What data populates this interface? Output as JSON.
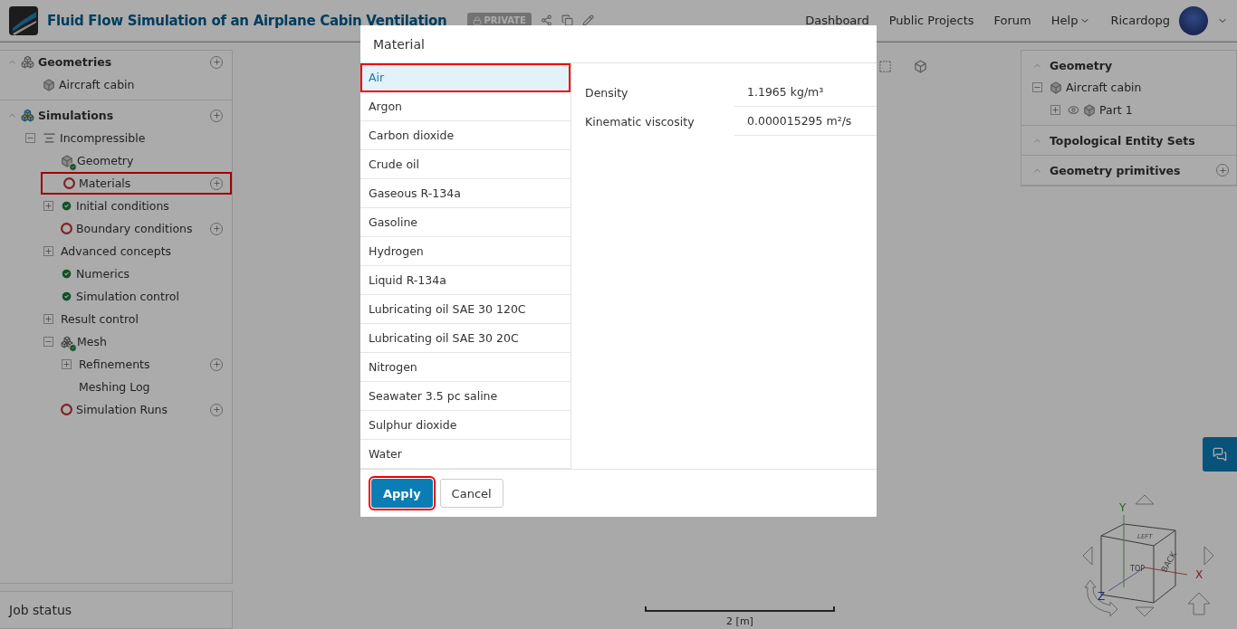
{
  "header": {
    "title": "Fluid Flow Simulation of an Airplane Cabin Ventilation",
    "badge": "PRIVATE",
    "nav": [
      {
        "label": "Dashboard",
        "menu": false
      },
      {
        "label": "Public Projects",
        "menu": false
      },
      {
        "label": "Forum",
        "menu": false
      },
      {
        "label": "Help",
        "menu": true
      }
    ],
    "user": "Ricardopg"
  },
  "left_tree": [
    {
      "label": "Geometries",
      "kind": "cubes",
      "addable": true,
      "children": [
        {
          "label": "Aircraft cabin",
          "kind": "part"
        }
      ]
    },
    {
      "label": "Simulations",
      "kind": "cubes-color",
      "addable": true,
      "children": [
        {
          "label": "Incompressible",
          "kind": "lines",
          "expanded": true,
          "children": [
            {
              "label": "Geometry",
              "kind": "part",
              "complete": true
            },
            {
              "label": "Materials",
              "kind": "plain",
              "complete": false,
              "addable": true,
              "highlighted": true
            },
            {
              "label": "Initial conditions",
              "kind": "plain",
              "complete": true,
              "expanded": false
            },
            {
              "label": "Boundary conditions",
              "kind": "plain",
              "complete": false,
              "addable": true
            },
            {
              "label": "Advanced concepts",
              "kind": "plain",
              "expanded": false
            },
            {
              "label": "Numerics",
              "kind": "plain",
              "complete": true
            },
            {
              "label": "Simulation control",
              "kind": "plain",
              "complete": true
            },
            {
              "label": "Result control",
              "kind": "plain",
              "expanded": false
            },
            {
              "label": "Mesh",
              "kind": "mesh",
              "complete": true,
              "expanded": true,
              "children": [
                {
                  "label": "Refinements",
                  "expanded": false,
                  "addable": true
                },
                {
                  "label": "Meshing Log"
                }
              ]
            },
            {
              "label": "Simulation Runs",
              "kind": "plain",
              "complete": false,
              "addable": true
            }
          ]
        }
      ]
    }
  ],
  "job_status": {
    "title": "Job status"
  },
  "right_panel": [
    {
      "title": "Geometry",
      "tree": [
        {
          "label": "Aircraft cabin",
          "expanded": true,
          "children": [
            {
              "label": "Part 1",
              "expanded": false,
              "visible": true
            }
          ]
        }
      ]
    },
    {
      "title": "Topological Entity Sets"
    },
    {
      "title": "Geometry primitives",
      "addable": true
    }
  ],
  "viewer": {
    "scale": "2 [m]",
    "cube_faces": [
      "LEFT",
      "TOP",
      "BACK"
    ],
    "axes": [
      "X",
      "Y",
      "Z"
    ]
  },
  "dialog": {
    "title": "Material",
    "materials": [
      {
        "label": "Air",
        "selected": true,
        "highlighted": true
      },
      {
        "label": "Argon",
        "selected": false
      },
      {
        "label": "Carbon dioxide",
        "selected": false
      },
      {
        "label": "Crude oil",
        "selected": false
      },
      {
        "label": "Gaseous R-134a",
        "selected": false
      },
      {
        "label": "Gasoline",
        "selected": false
      },
      {
        "label": "Hydrogen",
        "selected": false
      },
      {
        "label": "Liquid R-134a",
        "selected": false
      },
      {
        "label": "Lubricating oil SAE 30 120C",
        "selected": false
      },
      {
        "label": "Lubricating oil SAE 30 20C",
        "selected": false
      },
      {
        "label": "Nitrogen",
        "selected": false
      },
      {
        "label": "Seawater 3.5 pc saline",
        "selected": false
      },
      {
        "label": "Sulphur dioxide",
        "selected": false
      },
      {
        "label": "Water",
        "selected": false
      }
    ],
    "properties": [
      {
        "name": "Density",
        "value": "1.1965 kg/m³"
      },
      {
        "name": "Kinematic viscosity",
        "value": "0.000015295 m²/s"
      }
    ],
    "buttons": [
      {
        "label": "Apply",
        "kind": "primary",
        "highlighted": true
      },
      {
        "label": "Cancel",
        "kind": "secondary",
        "highlighted": false
      }
    ]
  }
}
